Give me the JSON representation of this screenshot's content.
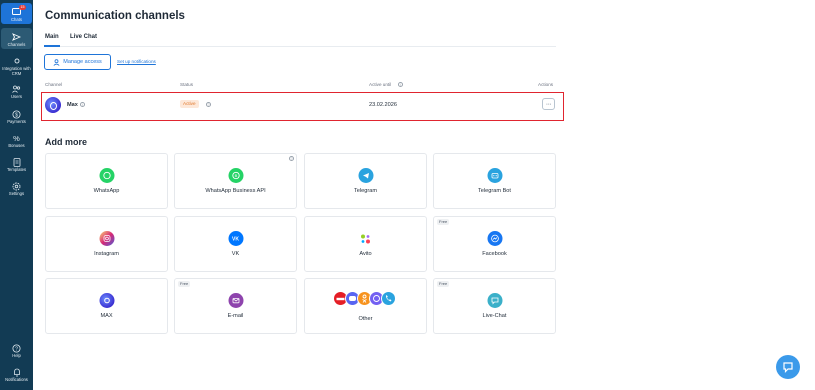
{
  "sidebar": {
    "items": [
      {
        "label": "Chats",
        "badge": "15"
      },
      {
        "label": "Channels"
      },
      {
        "label": "Integration with CRM"
      },
      {
        "label": "Users"
      },
      {
        "label": "Payments"
      },
      {
        "label": "Bonuses"
      },
      {
        "label": "Templates"
      },
      {
        "label": "Settings"
      }
    ],
    "bottom": [
      {
        "label": "Help"
      },
      {
        "label": "Notifications"
      }
    ]
  },
  "page": {
    "title": "Communication channels",
    "tabs": [
      {
        "label": "Main"
      },
      {
        "label": "Live Chat"
      }
    ],
    "manage_access_label": "Manage access",
    "setup_notifications_label": "Set up notifications"
  },
  "table": {
    "headers": {
      "channel": "Channel",
      "status": "Status",
      "active_until": "Active until",
      "actions": "Actions"
    },
    "rows": [
      {
        "name": "Max",
        "status": "Active",
        "active_until": "23.02.2026",
        "actions": "···"
      }
    ]
  },
  "add_more": {
    "title": "Add more",
    "free_label": "Free",
    "cards": [
      {
        "label": "WhatsApp",
        "icon": "whatsapp-icon",
        "color": "#25d366"
      },
      {
        "label": "WhatsApp Business API",
        "icon": "whatsapp-business-icon",
        "color": "#25d366"
      },
      {
        "label": "Telegram",
        "icon": "telegram-icon",
        "color": "#2aa3df"
      },
      {
        "label": "Telegram Bot",
        "icon": "telegram-bot-icon",
        "color": "#2aa3df"
      },
      {
        "label": "Instagram",
        "icon": "instagram-icon",
        "color": "#e1306c"
      },
      {
        "label": "VK",
        "icon": "vk-icon",
        "color": "#0077ff"
      },
      {
        "label": "Avito",
        "icon": "avito-icon",
        "color": "#97cf26"
      },
      {
        "label": "Facebook",
        "icon": "messenger-icon",
        "color": "#1877f2"
      },
      {
        "label": "MAX",
        "icon": "max-icon",
        "color": "#4a3fdc"
      },
      {
        "label": "E-mail",
        "icon": "email-icon",
        "color": "#8e44ad"
      },
      {
        "label": "Other",
        "icon": "other-icons",
        "color": "#555555"
      },
      {
        "label": "Live-Chat",
        "icon": "live-chat-icon",
        "color": "#3bb0c9"
      }
    ]
  },
  "colors": {
    "sidebar": "#123b54",
    "accent": "#1e74d8",
    "highlight": "#e0252f"
  }
}
